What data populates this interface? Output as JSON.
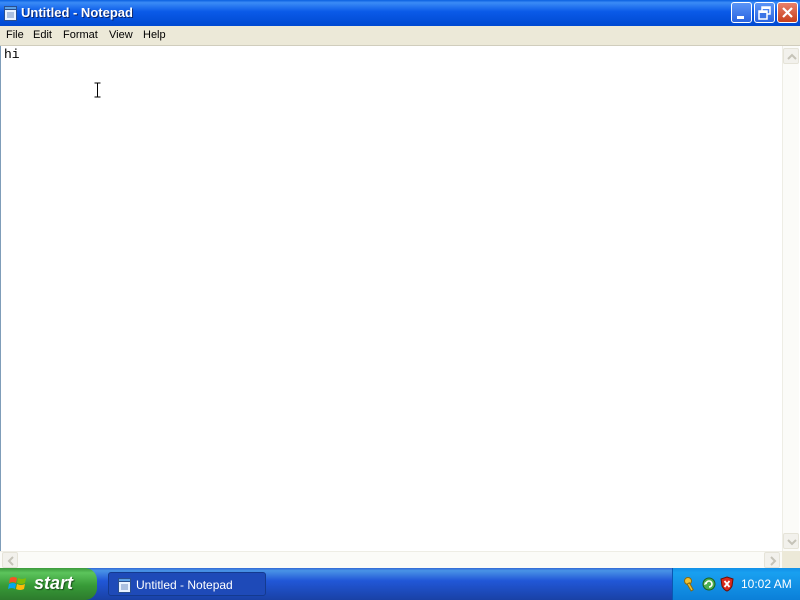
{
  "window": {
    "title": "Untitled - Notepad",
    "app_icon": "notepad-icon"
  },
  "menu": {
    "items": [
      "File",
      "Edit",
      "Format",
      "View",
      "Help"
    ]
  },
  "editor": {
    "content": "hi"
  },
  "taskbar": {
    "start_label": "start",
    "tasks": [
      {
        "label": "Untitled - Notepad",
        "icon": "notepad-icon"
      }
    ],
    "tray_icons": [
      "network-key-icon",
      "network-refresh-icon",
      "security-shield-icon"
    ],
    "clock": "10:02 AM"
  },
  "colors": {
    "titlebar_blue": "#0a5ae8",
    "close_red": "#c8401c",
    "menubar_bg": "#ece9d8",
    "start_green": "#379a37",
    "taskbar_blue": "#2157d7",
    "tray_blue": "#0b7fd8"
  }
}
